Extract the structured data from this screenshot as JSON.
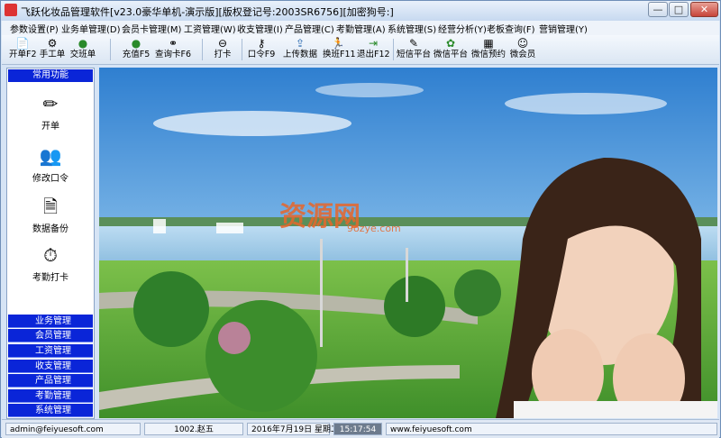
{
  "window": {
    "title": "飞跃化妆品管理软件[v23.0豪华单机-演示版][版权登记号:2003SR6756][加密狗号:]",
    "minimize_label": "—",
    "maximize_label": "□",
    "close_label": "✕"
  },
  "menu": [
    "参数设置(P)",
    "业务单管理(D)",
    "会员卡管理(M)",
    "工资管理(W)",
    "收支管理(I)",
    "产品管理(C)",
    "考勤管理(A)",
    "系统管理(S)",
    "经营分析(Y)",
    "老板查询(F)",
    "营销管理(Y)"
  ],
  "toolbar": [
    {
      "label": "开单F2",
      "icon": "document-icon"
    },
    {
      "label": "手工单",
      "icon": "gear-icon"
    },
    {
      "label": "交班单",
      "icon": "money-bag-icon"
    },
    {
      "label": "充值F5",
      "icon": "money-bag-icon"
    },
    {
      "label": "查询卡F6",
      "icon": "binoculars-icon"
    },
    {
      "label": "打卡",
      "icon": "clock-icon"
    },
    {
      "label": "口令F9",
      "icon": "key-icon"
    },
    {
      "label": "上传数据",
      "icon": "upload-icon"
    },
    {
      "label": "换班F11",
      "icon": "person-run-icon"
    },
    {
      "label": "退出F12",
      "icon": "exit-icon"
    },
    {
      "label": "短信平台",
      "icon": "sms-icon"
    },
    {
      "label": "微信平台",
      "icon": "wechat-icon"
    },
    {
      "label": "微信预约",
      "icon": "calendar-icon"
    },
    {
      "label": "微会员",
      "icon": "member-icon"
    }
  ],
  "sidebar": {
    "header": "常用功能",
    "buttons": [
      {
        "label": "开单",
        "icon": "pencil-icon"
      },
      {
        "label": "修改口令",
        "icon": "users-icon"
      },
      {
        "label": "数据备份",
        "icon": "backup-icon"
      },
      {
        "label": "考勤打卡",
        "icon": "clock-icon"
      }
    ],
    "categories": [
      "业务管理",
      "会员管理",
      "工资管理",
      "收支管理",
      "产品管理",
      "考勤管理",
      "系统管理"
    ]
  },
  "watermark": {
    "brand": "资源网",
    "domain": "9ozye.com"
  },
  "status": {
    "email": "admin@feiyuesoft.com",
    "user": "1002.赵五",
    "date": "2016年7月19日 星期二",
    "time": "15:17:54",
    "website": "www.feiyuesoft.com"
  },
  "colors": {
    "accent": "#0a25d8",
    "window": "#d6e4f5"
  }
}
